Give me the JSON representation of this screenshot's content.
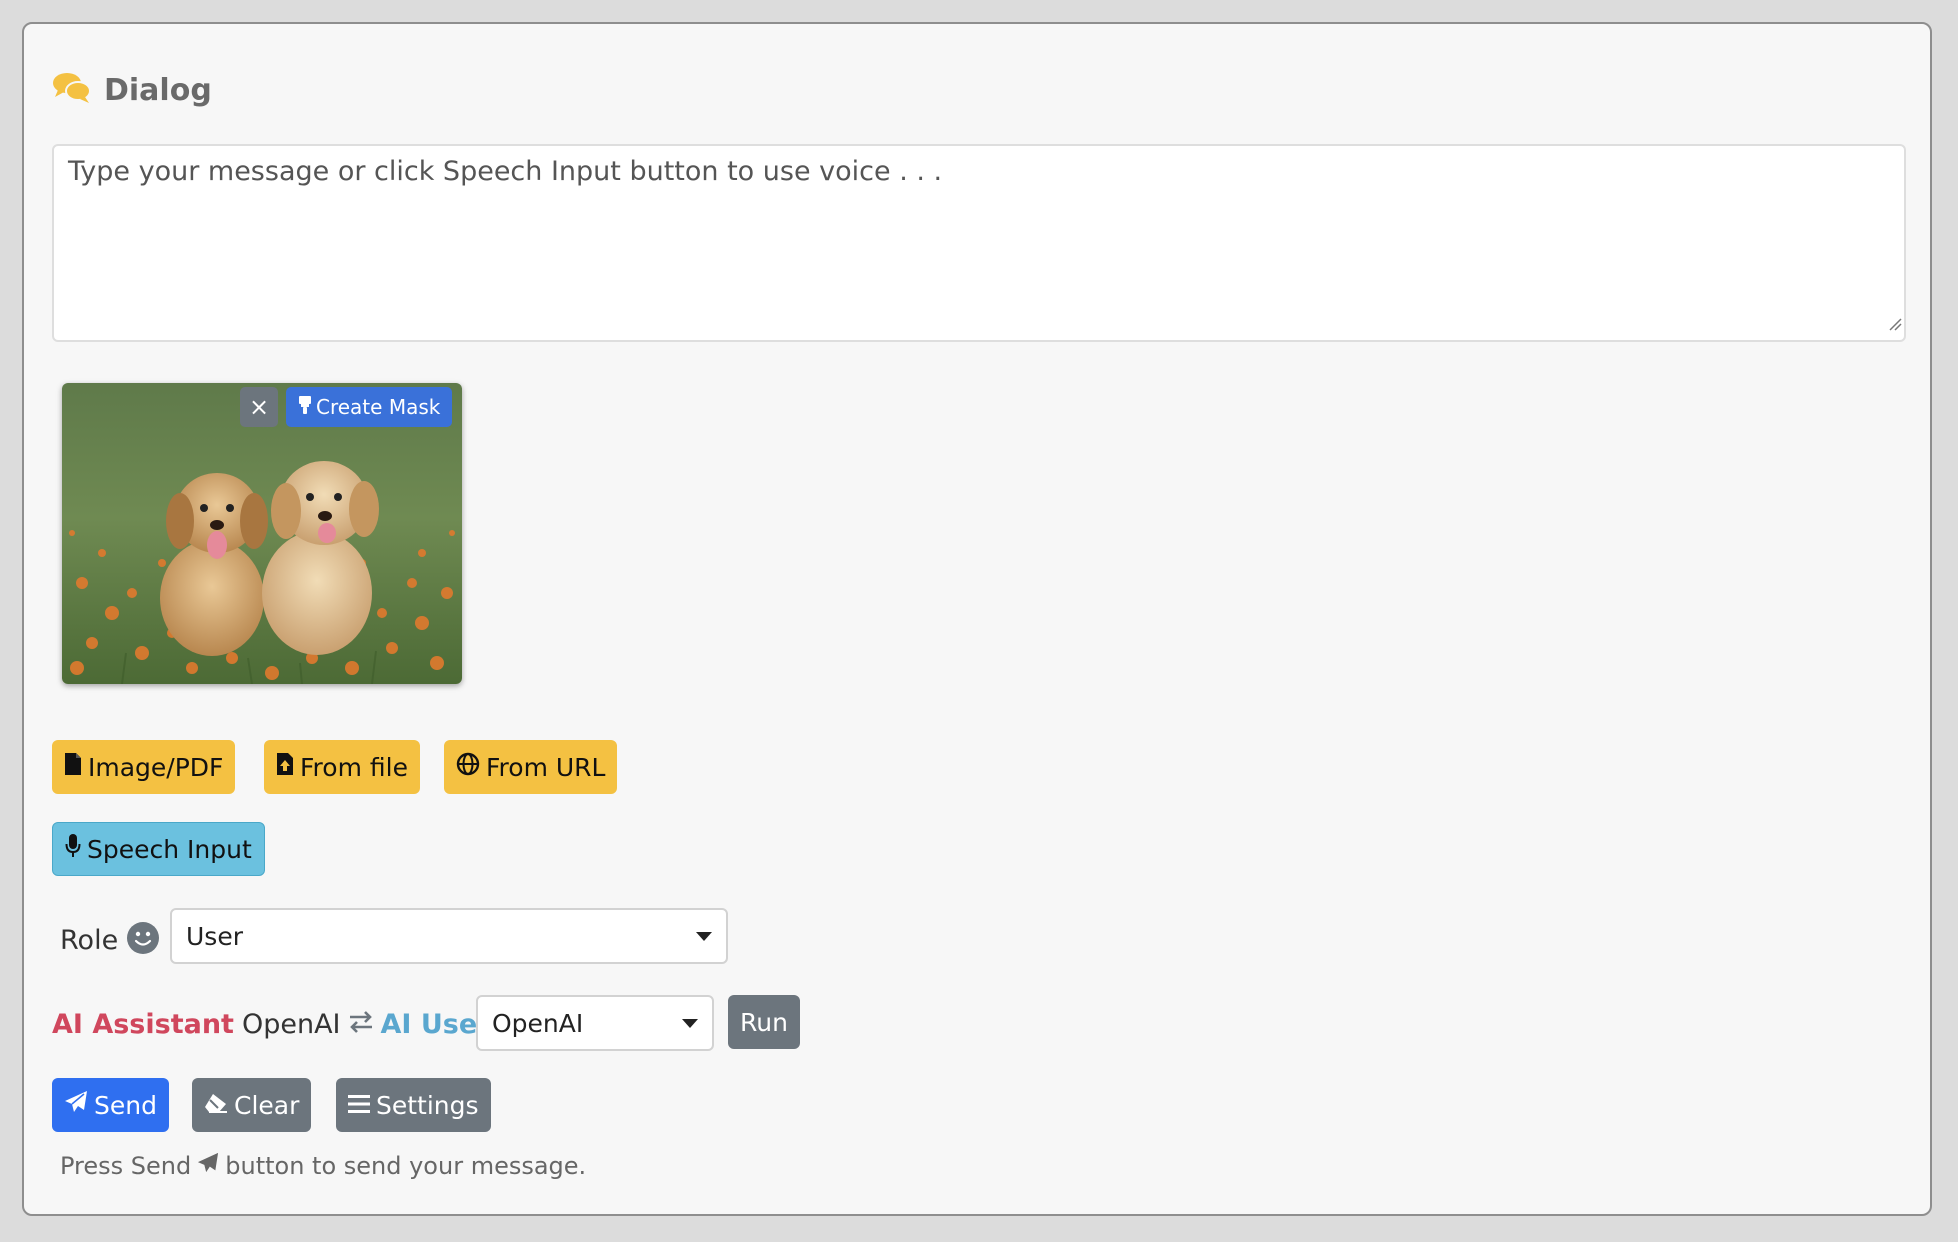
{
  "panel": {
    "title": "Dialog",
    "title_icon": "comments-icon"
  },
  "message": {
    "placeholder": "Type your message or click Speech Input button to use voice . . ."
  },
  "image_card": {
    "close_label": "×",
    "create_mask_label": "Create Mask",
    "create_mask_icon": "mask-brush-icon",
    "image_description": "two golden retriever puppies in a field of orange flowers"
  },
  "attach_buttons": [
    {
      "label": "Image/PDF",
      "icon": "file-icon"
    },
    {
      "label": "From file",
      "icon": "file-upload-icon"
    },
    {
      "label": "From URL",
      "icon": "globe-icon"
    }
  ],
  "speech": {
    "label": "Speech Input",
    "icon": "microphone-icon"
  },
  "role": {
    "label": "Role",
    "icon": "smile-icon",
    "selected": "User"
  },
  "ai_row": {
    "assistant_label": "AI Assistant",
    "assistant_provider": "OpenAI",
    "swap_icon": "exchange-icon",
    "user_label": "AI User",
    "user_provider_selected": "OpenAI",
    "run_label": "Run"
  },
  "actions": {
    "send_label": "Send",
    "clear_label": "Clear",
    "settings_label": "Settings"
  },
  "hint": {
    "before": "Press Send",
    "after": "button to send your message."
  },
  "colors": {
    "accent_yellow": "#f4c142",
    "info_blue": "#6bc1df",
    "primary_blue": "#2f6ff0",
    "secondary_gray": "#6c757d",
    "assistant_red": "#d0475d",
    "user_blue": "#5aa7cf"
  }
}
